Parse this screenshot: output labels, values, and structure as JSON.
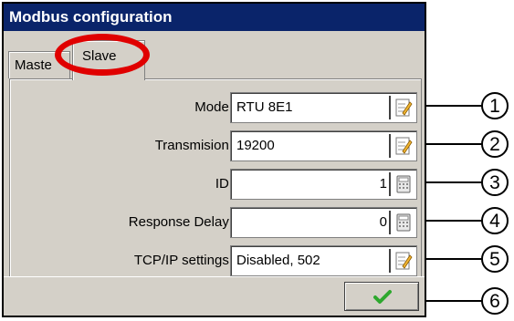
{
  "window": {
    "title": "Modbus configuration"
  },
  "tabs": [
    {
      "label": "Master",
      "visible_label": "Maste",
      "selected": false
    },
    {
      "label": "Slave",
      "selected": true
    }
  ],
  "fields": [
    {
      "label": "Mode:",
      "value": "RTU 8E1",
      "icon": "edit-icon"
    },
    {
      "label": "Transmision:",
      "value": "19200",
      "icon": "edit-icon"
    },
    {
      "label": "ID:",
      "value": "1",
      "icon": "numpad-icon"
    },
    {
      "label": "Response Delay:",
      "value": "0",
      "icon": "numpad-icon"
    },
    {
      "label": "TCP/IP settings:",
      "value": "Disabled, 502",
      "icon": "edit-icon"
    }
  ],
  "ok_button": {
    "icon": "checkmark-icon"
  },
  "callouts": [
    "1",
    "2",
    "3",
    "4",
    "5",
    "6"
  ],
  "colors": {
    "titlebar": "#0a246a",
    "highlight": "#e00000",
    "checkmark": "#2ea82e"
  }
}
